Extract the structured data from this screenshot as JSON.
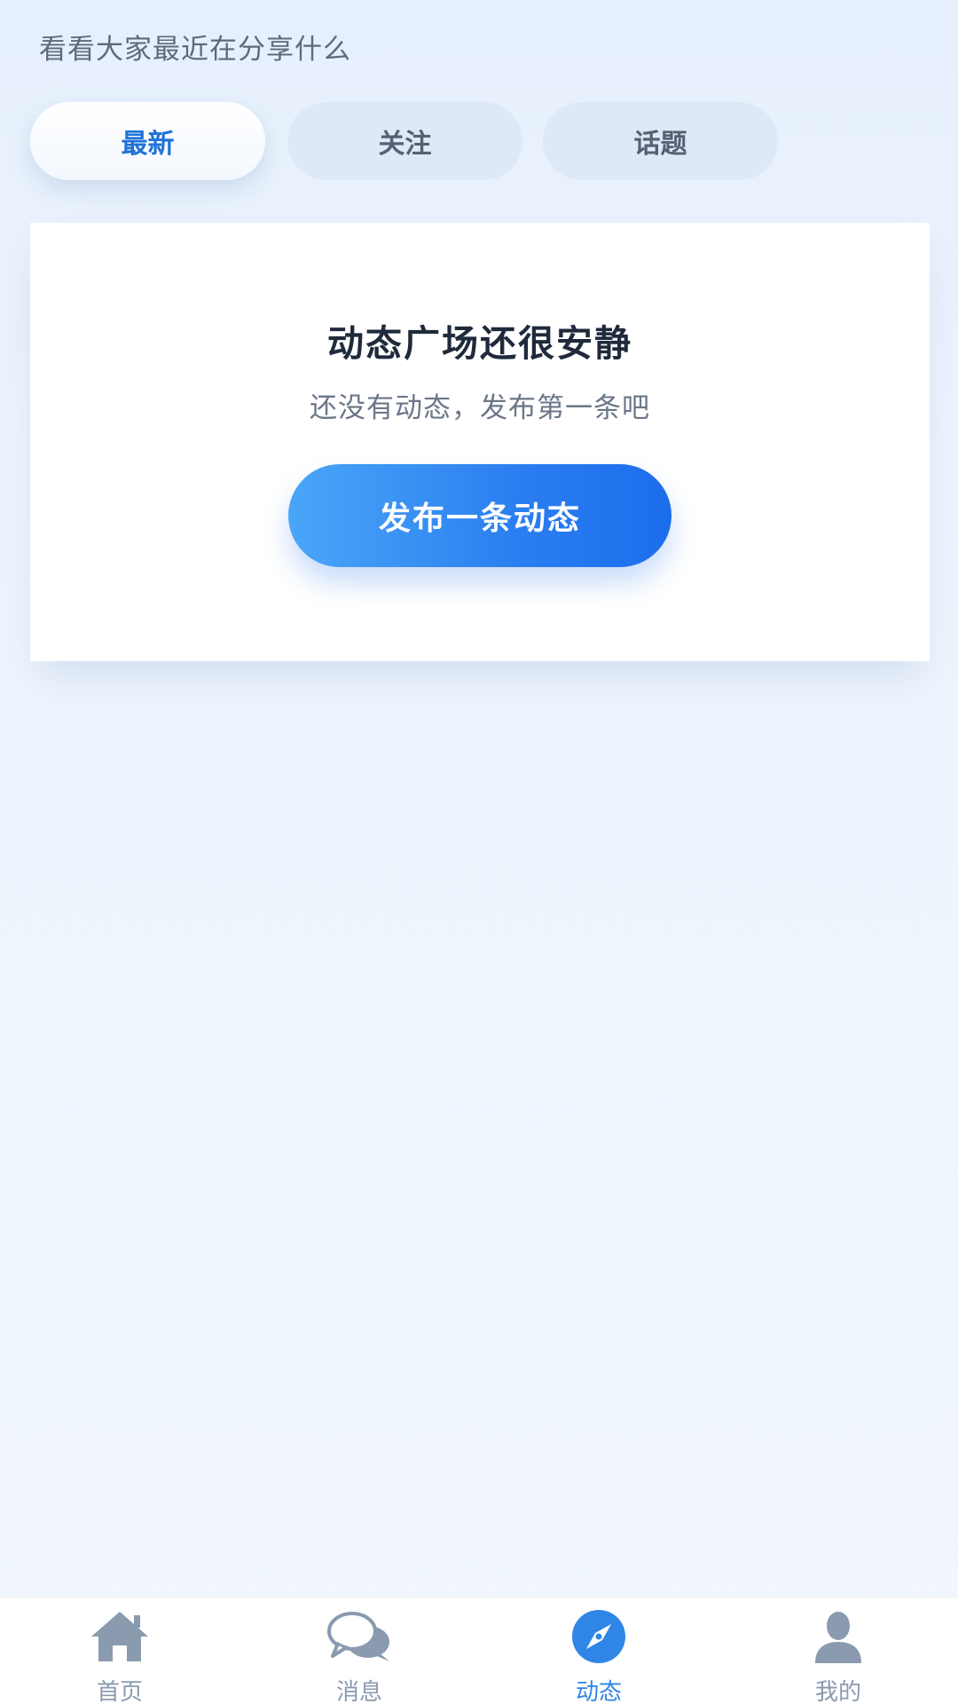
{
  "header": {
    "subtitle": "看看大家最近在分享什么"
  },
  "tabs": [
    {
      "label": "最新",
      "active": true
    },
    {
      "label": "关注",
      "active": false
    },
    {
      "label": "话题",
      "active": false
    }
  ],
  "empty_state": {
    "title": "动态广场还很安静",
    "description": "还没有动态，发布第一条吧",
    "button_label": "发布一条动态"
  },
  "bottom_nav": [
    {
      "label": "首页",
      "icon": "home-icon",
      "active": false
    },
    {
      "label": "消息",
      "icon": "chat-bubbles-icon",
      "active": false
    },
    {
      "label": "动态",
      "icon": "compass-icon",
      "active": true
    },
    {
      "label": "我的",
      "icon": "user-icon",
      "active": false
    }
  ],
  "colors": {
    "accent": "#2f86e6",
    "active_tab_text": "#1e72d7",
    "inactive_icon": "#8a9aaf",
    "button_gradient_start": "#4aa6f7",
    "button_gradient_end": "#1c6ded"
  }
}
